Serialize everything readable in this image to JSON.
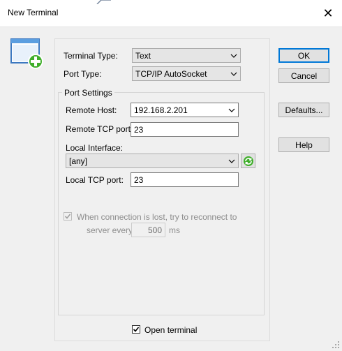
{
  "window": {
    "title": "New Terminal",
    "close_glyph": "✕"
  },
  "form": {
    "terminal_type": {
      "label": "Terminal Type:",
      "value": "Text"
    },
    "port_type": {
      "label": "Port Type:",
      "value": "TCP/IP AutoSocket"
    },
    "port_settings": {
      "group_title": "Port Settings",
      "remote_host": {
        "label": "Remote Host:",
        "value": "192.168.2.201"
      },
      "remote_tcp_port": {
        "label": "Remote TCP port:",
        "value": "23"
      },
      "local_interface": {
        "label": "Local Interface:",
        "value": "[any]"
      },
      "local_tcp_port": {
        "label": "Local TCP port:",
        "value": "23"
      },
      "reconnect": {
        "checked": true,
        "label_line1": "When connection is lost, try to reconnect to",
        "label_prefix": "server every",
        "interval": "500",
        "unit": "ms"
      }
    },
    "open_terminal": {
      "checked": true,
      "label": "Open terminal"
    }
  },
  "buttons": {
    "ok": "OK",
    "cancel": "Cancel",
    "defaults": "Defaults...",
    "help": "Help"
  },
  "icons": {
    "app": "new-terminal-window-icon",
    "refresh": "refresh-icon",
    "close": "close-icon",
    "dropdown": "chevron-down-icon",
    "check": "checkmark-icon"
  },
  "colors": {
    "accent": "#0078d7",
    "icon_green": "#3fae2a",
    "window_bg": "#f0f0f0"
  }
}
